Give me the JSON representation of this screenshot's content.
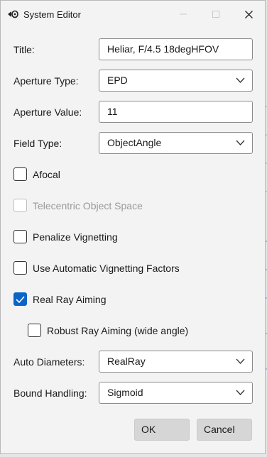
{
  "window": {
    "title": "System Editor"
  },
  "fields": {
    "title": {
      "label": "Title:",
      "value": "Heliar, F/4.5 18degHFOV"
    },
    "aperture_type": {
      "label": "Aperture Type:",
      "value": "EPD"
    },
    "aperture_value": {
      "label": "Aperture Value:",
      "value": "11"
    },
    "field_type": {
      "label": "Field Type:",
      "value": "ObjectAngle"
    },
    "auto_diameters": {
      "label": "Auto Diameters:",
      "value": "RealRay"
    },
    "bound_handling": {
      "label": "Bound Handling:",
      "value": "Sigmoid"
    }
  },
  "checkboxes": {
    "afocal": {
      "label": "Afocal",
      "checked": false,
      "enabled": true
    },
    "telecentric": {
      "label": "Telecentric Object Space",
      "checked": false,
      "enabled": false
    },
    "penalize_vignetting": {
      "label": "Penalize Vignetting",
      "checked": false,
      "enabled": true
    },
    "auto_vignetting": {
      "label": "Use Automatic Vignetting Factors",
      "checked": false,
      "enabled": true
    },
    "real_ray_aiming": {
      "label": "Real Ray Aiming",
      "checked": true,
      "enabled": true
    },
    "robust_ray_aiming": {
      "label": "Robust Ray Aiming (wide angle)",
      "checked": false,
      "enabled": true
    }
  },
  "buttons": {
    "ok": "OK",
    "cancel": "Cancel"
  },
  "colors": {
    "accent": "#0a64c8",
    "window_bg": "#f3f3f3",
    "button_bg": "#d6d6d6"
  }
}
